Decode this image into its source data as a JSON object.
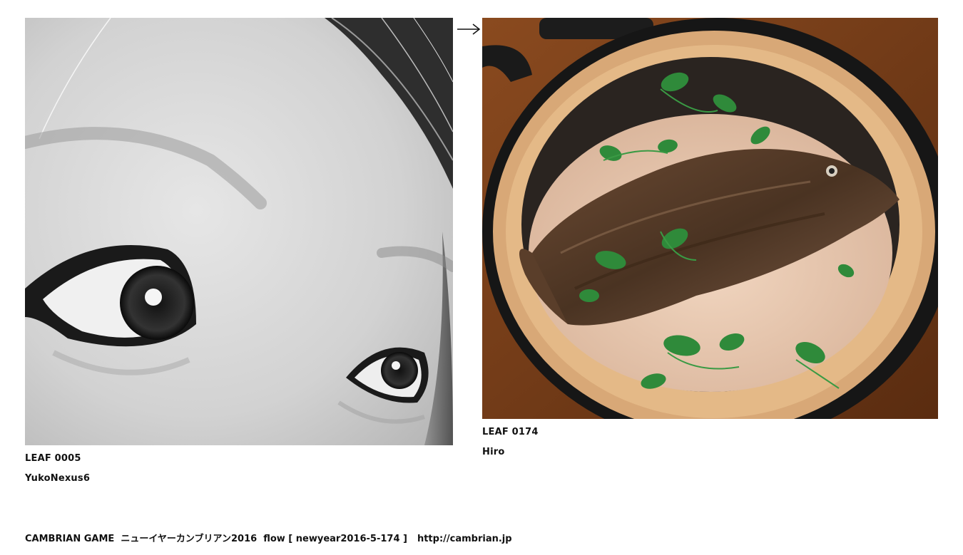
{
  "leaves": [
    {
      "id": "LEAF 0005",
      "author": "YukoNexus6",
      "photo_icon": "eyes-closeup-photo"
    },
    {
      "id": "LEAF 0174",
      "author": "Hiro",
      "photo_icon": "sea-bream-rice-pot-photo"
    }
  ],
  "connector_icon": "right-arrow-icon",
  "footer": {
    "game": "CAMBRIAN GAME",
    "title": "ニューイヤーカンブリアン2016",
    "flow": "flow [ newyear2016-5-174 ]",
    "url": "http://cambrian.jp"
  }
}
